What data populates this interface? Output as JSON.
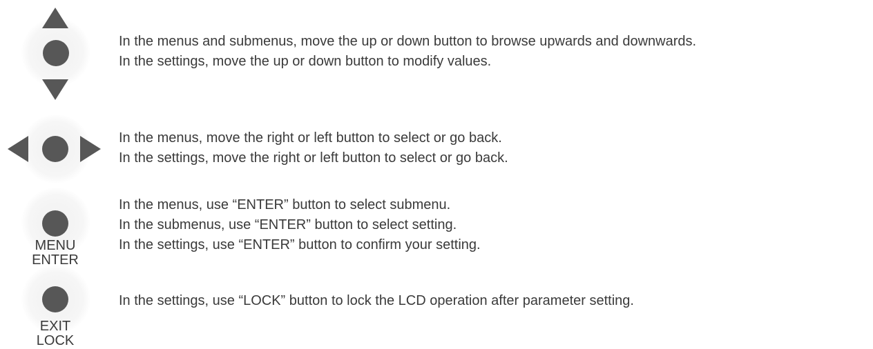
{
  "controls": [
    {
      "icon": "up-down-joystick-icon",
      "lines": [
        "In the menus and submenus, move the up or down button to browse upwards and downwards.",
        "In the settings, move the up or down button to modify values."
      ]
    },
    {
      "icon": "left-right-joystick-icon",
      "lines": [
        "In the menus, move the right or left button to select or go back.",
        "In the settings, move the right or left button to select or go back."
      ]
    },
    {
      "icon": "menu-enter-button-icon",
      "button_label": [
        "MENU",
        "ENTER"
      ],
      "lines": [
        "In the menus, use “ENTER” button to select submenu.",
        "In the submenus, use “ENTER” button to select setting.",
        "In the settings, use “ENTER” button to confirm your setting."
      ]
    },
    {
      "icon": "exit-lock-button-icon",
      "button_label": [
        "EXIT",
        "LOCK"
      ],
      "lines": [
        "In the settings, use “LOCK” button to lock the LCD operation after parameter setting."
      ]
    }
  ],
  "colors": {
    "icon": "#575757",
    "text": "#3a3a3a",
    "glow": "#f1f1f1"
  }
}
